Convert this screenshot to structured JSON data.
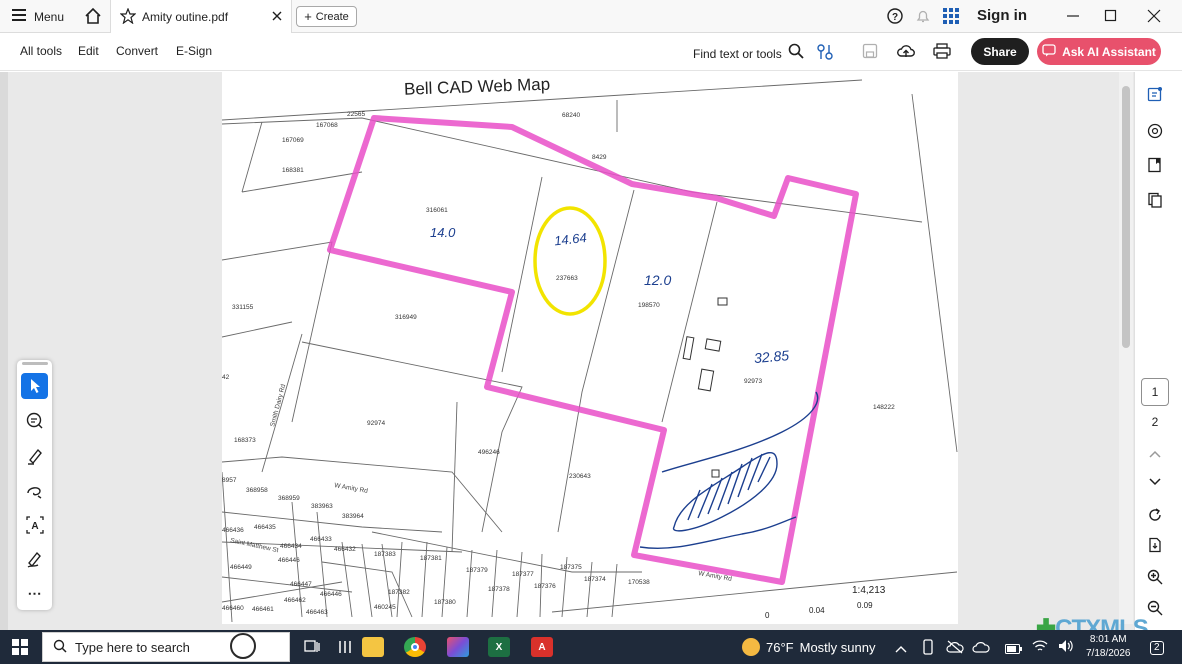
{
  "window": {
    "menu_label": "Menu",
    "tab_title": "Amity outine.pdf",
    "create_label": "Create",
    "sign_in_label": "Sign in"
  },
  "toolbar": {
    "all_tools": "All tools",
    "edit": "Edit",
    "convert": "Convert",
    "esign": "E-Sign",
    "find_text": "Find text or tools",
    "share_label": "Share",
    "ai_label": "Ask AI Assistant"
  },
  "document": {
    "map_title": "Bell CAD Web Map",
    "scale_label": "1:4,213",
    "scale_ticks": [
      "0",
      "0.04",
      "0.09"
    ],
    "handwritten": {
      "acres_a": "14.0",
      "acres_b": "14.64",
      "acres_c": "12.0",
      "acres_d": "32.85"
    },
    "parcels": {
      "p316061": "316061",
      "p237663": "237663",
      "p198570": "198570",
      "p92973": "92973",
      "p316949": "316949",
      "p331155": "331155",
      "p92974": "92974",
      "p496246": "496246",
      "p230643": "230643",
      "p148222": "148222",
      "p167068": "167068",
      "p167069": "167069",
      "p168381": "168381",
      "p22565": "22565",
      "p8429": "8429",
      "p68240": "68240",
      "p168373": "168373",
      "p368958": "368958",
      "p368959": "368959",
      "p383963": "383963",
      "p383964": "383964",
      "p466435": "466435",
      "p466436": "466436",
      "p466434": "466434",
      "p466433": "466433",
      "p466446": "466446",
      "p466432": "466432",
      "p466449": "466449",
      "p466447": "466447",
      "p466446b": "466446",
      "p466462": "466462",
      "p466461": "466461",
      "p466460": "466460",
      "p466463": "466463",
      "p187383": "187383",
      "p187381": "187381",
      "p187382": "187382",
      "p187380": "187380",
      "p187379": "187379",
      "p187378": "187378",
      "p187377": "187377",
      "p187376": "187376",
      "p187375": "187375",
      "p187374": "187374",
      "p170538": "170538",
      "p460245": "460245",
      "p8957": "8957",
      "p42": "42"
    },
    "roads": {
      "amity_rd": "W Amity Rd",
      "smith_dairy": "Smith Dairy Rd",
      "saint_matthew": "Saint Matthew St"
    }
  },
  "right_panel": {
    "page_1": "1",
    "page_2": "2"
  },
  "taskbar": {
    "search_placeholder": "Type here to search",
    "temperature": "76°F",
    "weather_text": "Mostly sunny",
    "time": "8:01 AM",
    "date": "7/18/2026",
    "notification_count": "2"
  },
  "watermark": {
    "text": "CTXMLS"
  },
  "colors": {
    "highlight_pink": "#e94fc8",
    "circle_yellow": "#f2e400",
    "ink_blue": "#1c3f8f",
    "share_dark": "#1f1f1f",
    "ai_pink": "#e8516c",
    "taskbar": "#1f2a3a"
  }
}
